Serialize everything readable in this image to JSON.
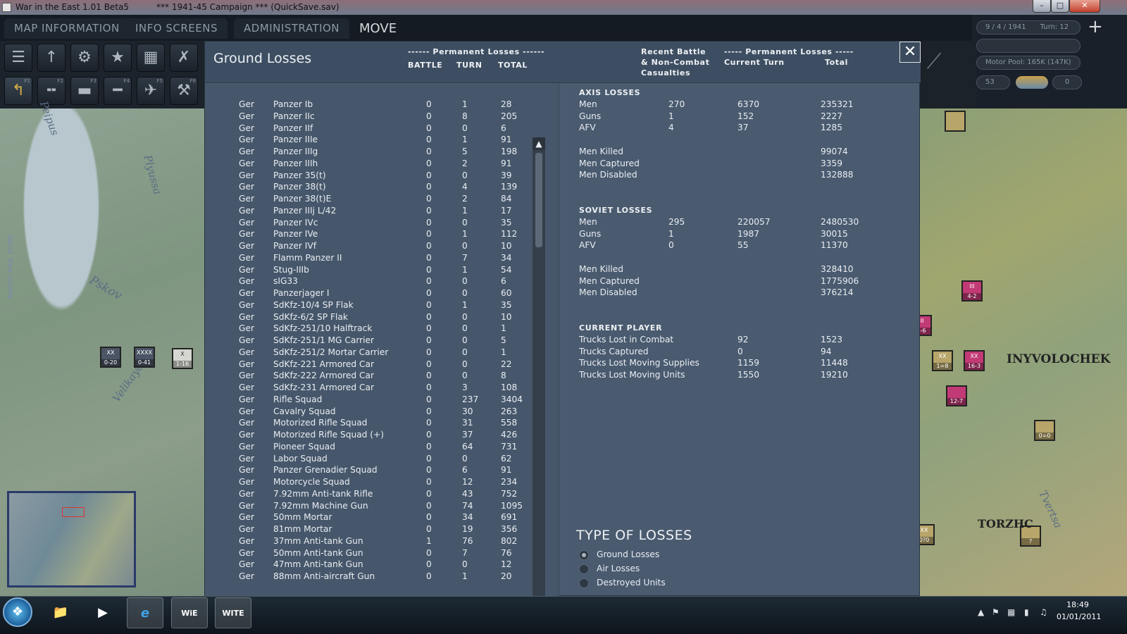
{
  "window": {
    "app_title": "War in the East 1.01 Beta5",
    "campaign_title": "***   1941-45 Campaign   ***  (QuickSave.sav)",
    "minimize": "–",
    "maximize": "□",
    "close": "✕"
  },
  "menu": {
    "tabs": [
      "MAP INFORMATION",
      "INFO SCREENS",
      "ADMINISTRATION"
    ],
    "mode": "MOVE"
  },
  "toolbar": {
    "row1_icons": [
      "layers-icon",
      "unit-icon",
      "gear-icon",
      "star-icon",
      "hq-icon",
      "combat-icon"
    ],
    "row2_icons": [
      "move-icon",
      "rail-icon",
      "naval-icon",
      "air-transport-icon",
      "air-icon",
      "build-icon"
    ],
    "fkeys": [
      "F1",
      "F2",
      "F3",
      "F4",
      "F5",
      "F6"
    ]
  },
  "status": {
    "date": "9 / 4 / 1941",
    "turn": "Turn: 12",
    "motor_pool": "Motor Pool: 165K (147K)",
    "value": "53",
    "counter": "0"
  },
  "map": {
    "labels_left": [
      "Peipus",
      "Plyussa",
      "Pskov",
      "Velikaya",
      "BALTIC RAIL ZONE"
    ],
    "labels_right": [
      "INYVOLOCHEK",
      "TORZHC",
      "Tvertsa"
    ],
    "units_left": [
      {
        "top": "XX",
        "label": "0-20"
      },
      {
        "top": "XXXX",
        "label": "0-41"
      },
      {
        "top": "X",
        "label": "1-16"
      }
    ],
    "units_right": [
      {
        "top": "III",
        "label": "4-2"
      },
      {
        "top": "III",
        "label": "4-6"
      },
      {
        "top": "XX",
        "label": "1=8"
      },
      {
        "top": "XX",
        "label": "16-3"
      },
      {
        "top": "",
        "label": "12-7"
      },
      {
        "top": "",
        "label": "0=0"
      },
      {
        "top": "XX",
        "label": "0?0"
      },
      {
        "top": "",
        "label": "?"
      }
    ]
  },
  "panel": {
    "title": "Ground Losses",
    "perm_header": "------ Permanent Losses ------",
    "col_battle": "BATTLE",
    "col_turn": "TURN",
    "col_total": "TOTAL",
    "recent_header": "Recent Battle",
    "recent_header2": "& Non-Combat",
    "recent_header3": "Casualties",
    "perm_header2": "----- Permanent Losses -----",
    "current_turn": "Current Turn",
    "total": "Total",
    "close_label": "✕"
  },
  "losses": [
    [
      "Ger",
      "Panzer Ib",
      "0",
      "1",
      "28"
    ],
    [
      "Ger",
      "Panzer IIc",
      "0",
      "8",
      "205"
    ],
    [
      "Ger",
      "Panzer IIf",
      "0",
      "0",
      "6"
    ],
    [
      "Ger",
      "Panzer IIIe",
      "0",
      "1",
      "91"
    ],
    [
      "Ger",
      "Panzer IIIg",
      "0",
      "5",
      "198"
    ],
    [
      "Ger",
      "Panzer IIIh",
      "0",
      "2",
      "91"
    ],
    [
      "Ger",
      "Panzer 35(t)",
      "0",
      "0",
      "39"
    ],
    [
      "Ger",
      "Panzer 38(t)",
      "0",
      "4",
      "139"
    ],
    [
      "Ger",
      "Panzer 38(t)E",
      "0",
      "2",
      "84"
    ],
    [
      "Ger",
      "Panzer IIIj L/42",
      "0",
      "1",
      "17"
    ],
    [
      "Ger",
      "Panzer IVc",
      "0",
      "0",
      "35"
    ],
    [
      "Ger",
      "Panzer IVe",
      "0",
      "1",
      "112"
    ],
    [
      "Ger",
      "Panzer IVf",
      "0",
      "0",
      "10"
    ],
    [
      "Ger",
      "Flamm Panzer II",
      "0",
      "7",
      "34"
    ],
    [
      "Ger",
      "Stug-IIIb",
      "0",
      "1",
      "54"
    ],
    [
      "Ger",
      "sIG33",
      "0",
      "0",
      "6"
    ],
    [
      "Ger",
      "Panzerjager I",
      "0",
      "0",
      "60"
    ],
    [
      "Ger",
      "SdKfz-10/4 SP Flak",
      "0",
      "1",
      "35"
    ],
    [
      "Ger",
      "SdKfz-6/2 SP Flak",
      "0",
      "0",
      "10"
    ],
    [
      "Ger",
      "SdKfz-251/10 Halftrack",
      "0",
      "0",
      "1"
    ],
    [
      "Ger",
      "SdKfz-251/1 MG Carrier",
      "0",
      "0",
      "5"
    ],
    [
      "Ger",
      "SdKfz-251/2 Mortar Carrier",
      "0",
      "0",
      "1"
    ],
    [
      "Ger",
      "SdKfz-221 Armored Car",
      "0",
      "0",
      "22"
    ],
    [
      "Ger",
      "SdKfz-222 Armored Car",
      "0",
      "0",
      "8"
    ],
    [
      "Ger",
      "SdKfz-231 Armored Car",
      "0",
      "3",
      "108"
    ],
    [
      "Ger",
      "Rifle Squad",
      "0",
      "237",
      "3404"
    ],
    [
      "Ger",
      "Cavalry Squad",
      "0",
      "30",
      "263"
    ],
    [
      "Ger",
      "Motorized Rifle Squad",
      "0",
      "31",
      "558"
    ],
    [
      "Ger",
      "Motorized Rifle Squad (+)",
      "0",
      "37",
      "426"
    ],
    [
      "Ger",
      "Pioneer Squad",
      "0",
      "64",
      "731"
    ],
    [
      "Ger",
      "Labor Squad",
      "0",
      "0",
      "62"
    ],
    [
      "Ger",
      "Panzer Grenadier Squad",
      "0",
      "6",
      "91"
    ],
    [
      "Ger",
      "Motorcycle Squad",
      "0",
      "12",
      "234"
    ],
    [
      "Ger",
      "7.92mm Anti-tank Rifle",
      "0",
      "43",
      "752"
    ],
    [
      "Ger",
      "7.92mm Machine Gun",
      "0",
      "74",
      "1095"
    ],
    [
      "Ger",
      "50mm Mortar",
      "0",
      "34",
      "691"
    ],
    [
      "Ger",
      "81mm Mortar",
      "0",
      "19",
      "356"
    ],
    [
      "Ger",
      "37mm Anti-tank Gun",
      "1",
      "76",
      "802"
    ],
    [
      "Ger",
      "50mm Anti-tank Gun",
      "0",
      "7",
      "76"
    ],
    [
      "Ger",
      "47mm Anti-tank Gun",
      "0",
      "0",
      "12"
    ],
    [
      "Ger",
      "88mm Anti-aircraft Gun",
      "0",
      "1",
      "20"
    ]
  ],
  "axis": {
    "title": "AXIS LOSSES",
    "rows": [
      [
        "Men",
        "270",
        "6370",
        "235321"
      ],
      [
        "Guns",
        "1",
        "152",
        "2227"
      ],
      [
        "AFV",
        "4",
        "37",
        "1285"
      ]
    ],
    "casualties": [
      [
        "Men Killed",
        "99074"
      ],
      [
        "Men Captured",
        "3359"
      ],
      [
        "Men Disabled",
        "132888"
      ]
    ]
  },
  "soviet": {
    "title": "SOVIET LOSSES",
    "rows": [
      [
        "Men",
        "295",
        "220057",
        "2480530"
      ],
      [
        "Guns",
        "1",
        "1987",
        "30015"
      ],
      [
        "AFV",
        "0",
        "55",
        "11370"
      ]
    ],
    "casualties": [
      [
        "Men Killed",
        "328410"
      ],
      [
        "Men Captured",
        "1775906"
      ],
      [
        "Men Disabled",
        "376214"
      ]
    ]
  },
  "player": {
    "title": "CURRENT PLAYER",
    "rows": [
      [
        "Trucks Lost in Combat",
        "92",
        "1523"
      ],
      [
        "Trucks Captured",
        "0",
        "94"
      ],
      [
        "Trucks Lost Moving Supplies",
        "1159",
        "11448"
      ],
      [
        "Trucks Lost Moving Units",
        "1550",
        "19210"
      ]
    ]
  },
  "type_of_losses": {
    "title": "TYPE OF LOSSES",
    "options": [
      "Ground Losses",
      "Air Losses",
      "Destroyed Units"
    ],
    "selected": 0
  },
  "taskbar": {
    "apps": [
      "explorer-icon",
      "media-player-icon",
      "ie-icon",
      "witw-icon",
      "witf-icon"
    ],
    "app_labels": [
      "📁",
      "▶",
      "e",
      "WiE",
      "WITE"
    ],
    "time": "18:49",
    "date": "01/01/2011"
  },
  "colors": {
    "panel": "#4a5b70",
    "panel_header": "#3e4e62",
    "text": "#e9edf1",
    "accent_selected": "#d8b04a"
  }
}
